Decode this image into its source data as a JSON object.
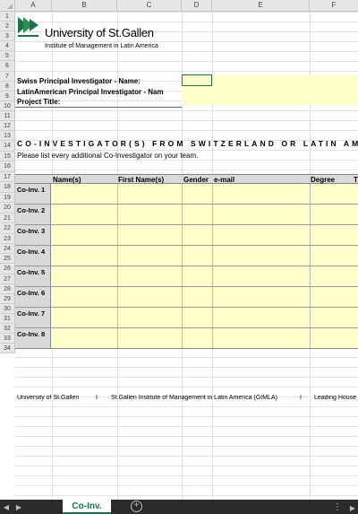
{
  "columns": [
    "A",
    "B",
    "C",
    "D",
    "E",
    "F"
  ],
  "rows": [
    "1",
    "2",
    "3",
    "4",
    "5",
    "6",
    "7",
    "8",
    "9",
    "10",
    "11",
    "12",
    "13",
    "14",
    "15",
    "16",
    "17",
    "18",
    "19",
    "20",
    "21",
    "22",
    "23",
    "24",
    "25",
    "26",
    "27",
    "28",
    "29",
    "30",
    "31",
    "32",
    "33",
    "34"
  ],
  "logo": {
    "university": "University of St.Gallen",
    "institute": "Institute of Management in Latin America"
  },
  "form": {
    "swiss_pi": "Swiss Principal Investigator - Name:",
    "latam_pi": "LatinAmerican Principal Investigator - Nam",
    "project_title": "Project Title:"
  },
  "section": {
    "heading": "CO-INVESTIGATOR(S) FROM SWITZERLAND OR LATIN AM",
    "instruction": "Please list every additional Co-Investigator on your team."
  },
  "table": {
    "headers": [
      "Name(s)",
      "First Name(s)",
      "Gender",
      "e-mail",
      "Degree",
      "T"
    ],
    "row_labels": [
      "Co-Inv. 1",
      "Co-Inv. 2",
      "Co-Inv. 3",
      "Co-Inv. 4",
      "Co-Inv. 5",
      "Co-Inv. 6",
      "Co-Inv. 7",
      "Co-Inv. 8"
    ]
  },
  "footer": {
    "part1": "University of St.Gallen",
    "sep1": "I",
    "part2": "St.Gallen Institute of Management in Latin America (GIMLA)",
    "sep2": "I",
    "part3": "Leading House"
  },
  "tabs": {
    "active": "Co-Inv.",
    "add": "+"
  },
  "colors": {
    "accent": "#1e7145",
    "input_fill": "#ffffcc",
    "header_fill": "#d9d9d9"
  }
}
